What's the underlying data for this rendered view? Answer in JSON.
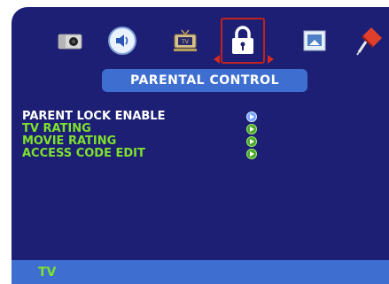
{
  "colors": {
    "panel_bg": "#1c1f73",
    "accent_blue": "#3e6fd0",
    "highlight_red": "#c0221f",
    "text_white": "#ffffff",
    "text_green": "#7fe12e"
  },
  "tabs": [
    {
      "icon": "camera-icon",
      "selected": false
    },
    {
      "icon": "speaker-icon",
      "selected": false
    },
    {
      "icon": "tv-icon",
      "selected": false
    },
    {
      "icon": "lock-icon",
      "selected": true
    },
    {
      "icon": "picture-icon",
      "selected": false
    },
    {
      "icon": "pushpin-icon",
      "selected": false
    }
  ],
  "menu": {
    "title": "PARENTAL CONTROL",
    "items": [
      {
        "label": "PARENT LOCK ENABLE",
        "state": "active"
      },
      {
        "label": "TV RATING",
        "state": "normal"
      },
      {
        "label": "MOVIE RATING",
        "state": "normal"
      },
      {
        "label": "ACCESS CODE EDIT",
        "state": "normal"
      }
    ]
  },
  "footer": {
    "source_label": "TV"
  }
}
